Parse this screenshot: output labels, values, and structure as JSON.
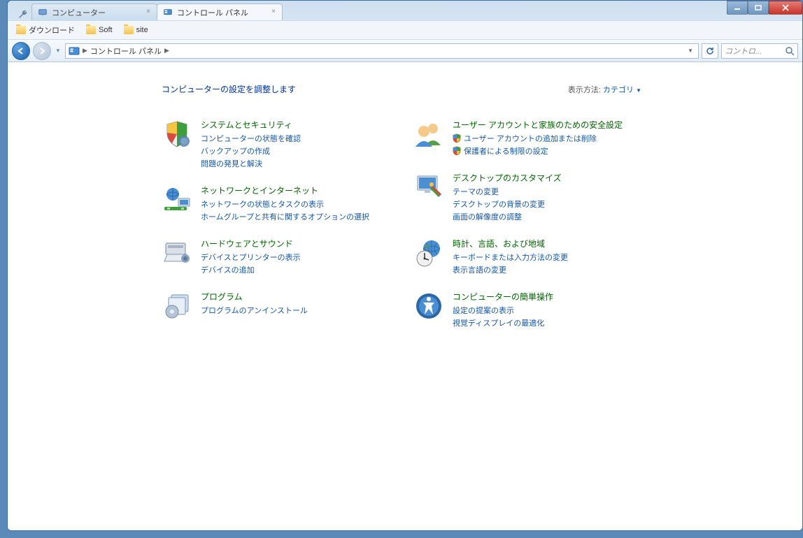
{
  "tabs": [
    {
      "label": "コンピューター"
    },
    {
      "label": "コントロール パネル"
    }
  ],
  "bookmarks": [
    {
      "label": "ダウンロード"
    },
    {
      "label": "Soft"
    },
    {
      "label": "site"
    }
  ],
  "breadcrumb": {
    "root": "コントロール パネル"
  },
  "search": {
    "placeholder": "コントロ..."
  },
  "heading": "コンピューターの設定を調整します",
  "view_by": {
    "label": "表示方法:",
    "value": "カテゴリ"
  },
  "categories": {
    "left": [
      {
        "title": "システムとセキュリティ",
        "links": [
          {
            "text": "コンピューターの状態を確認"
          },
          {
            "text": "バックアップの作成"
          },
          {
            "text": "問題の発見と解決"
          }
        ]
      },
      {
        "title": "ネットワークとインターネット",
        "links": [
          {
            "text": "ネットワークの状態とタスクの表示"
          },
          {
            "text": "ホームグループと共有に関するオプションの選択"
          }
        ]
      },
      {
        "title": "ハードウェアとサウンド",
        "links": [
          {
            "text": "デバイスとプリンターの表示"
          },
          {
            "text": "デバイスの追加"
          }
        ]
      },
      {
        "title": "プログラム",
        "links": [
          {
            "text": "プログラムのアンインストール"
          }
        ]
      }
    ],
    "right": [
      {
        "title": "ユーザー アカウントと家族のための安全設定",
        "links": [
          {
            "text": "ユーザー アカウントの追加または削除",
            "shield": true
          },
          {
            "text": "保護者による制限の設定",
            "shield": true
          }
        ]
      },
      {
        "title": "デスクトップのカスタマイズ",
        "links": [
          {
            "text": "テーマの変更"
          },
          {
            "text": "デスクトップの背景の変更"
          },
          {
            "text": "画面の解像度の調整"
          }
        ]
      },
      {
        "title": "時計、言語、および地域",
        "links": [
          {
            "text": "キーボードまたは入力方法の変更"
          },
          {
            "text": "表示言語の変更"
          }
        ]
      },
      {
        "title": "コンピューターの簡単操作",
        "links": [
          {
            "text": "設定の提案の表示"
          },
          {
            "text": "視覚ディスプレイの最適化"
          }
        ]
      }
    ]
  }
}
